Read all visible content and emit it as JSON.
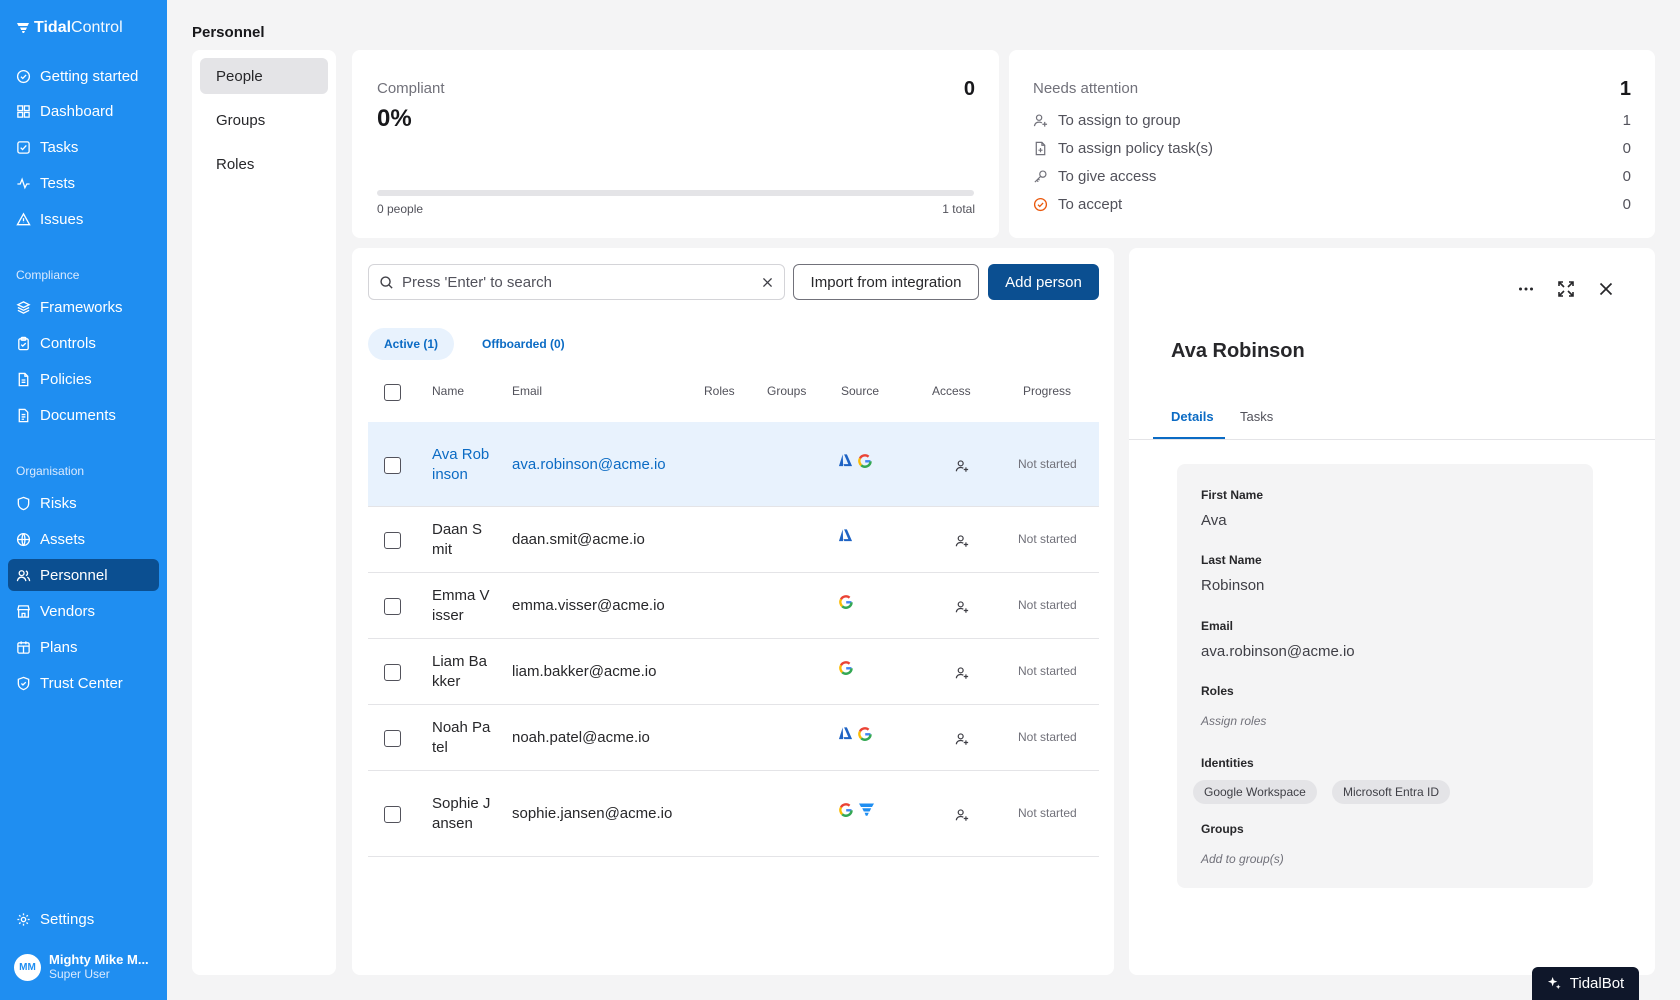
{
  "brand": {
    "bold": "Tidal",
    "light": "Control"
  },
  "nav": {
    "items": [
      {
        "label": "Getting started",
        "icon": "check-circle-icon"
      },
      {
        "label": "Dashboard",
        "icon": "grid-icon"
      },
      {
        "label": "Tasks",
        "icon": "checkbox-icon"
      },
      {
        "label": "Tests",
        "icon": "activity-icon"
      },
      {
        "label": "Issues",
        "icon": "warning-icon"
      }
    ],
    "compliance_label": "Compliance",
    "compliance_items": [
      {
        "label": "Frameworks",
        "icon": "layers-icon"
      },
      {
        "label": "Controls",
        "icon": "clipboard-icon"
      },
      {
        "label": "Policies",
        "icon": "file-icon"
      },
      {
        "label": "Documents",
        "icon": "document-icon"
      }
    ],
    "organisation_label": "Organisation",
    "organisation_items": [
      {
        "label": "Risks",
        "icon": "shield-icon"
      },
      {
        "label": "Assets",
        "icon": "globe-icon"
      },
      {
        "label": "Personnel",
        "icon": "users-icon"
      },
      {
        "label": "Vendors",
        "icon": "store-icon"
      },
      {
        "label": "Plans",
        "icon": "calendar-icon"
      },
      {
        "label": "Trust Center",
        "icon": "shield-check-icon"
      }
    ],
    "settings_label": "Settings"
  },
  "user": {
    "initials": "MM",
    "name": "Mighty Mike M...",
    "role": "Super User"
  },
  "page_title": "Personnel",
  "subnav": [
    "People",
    "Groups",
    "Roles"
  ],
  "compliant": {
    "label": "Compliant",
    "percent": "0%",
    "count": "0",
    "people_note": "0 people",
    "total_note": "1 total",
    "progress": 0
  },
  "needs_attention": {
    "label": "Needs attention",
    "count": "1",
    "rows": [
      {
        "label": "To assign to group",
        "count": "1",
        "icon": "user-plus-icon"
      },
      {
        "label": "To assign policy task(s)",
        "count": "0",
        "icon": "file-plus-icon"
      },
      {
        "label": "To give access",
        "count": "0",
        "icon": "key-icon"
      },
      {
        "label": "To accept",
        "count": "0",
        "icon": "check-circle-icon"
      }
    ]
  },
  "toolbar": {
    "search_placeholder": "Press 'Enter' to search",
    "import_label": "Import from integration",
    "add_label": "Add person"
  },
  "filters": {
    "active": "Active (1)",
    "offboarded": "Offboarded (0)"
  },
  "table": {
    "headers": {
      "name": "Name",
      "email": "Email",
      "roles": "Roles",
      "groups": "Groups",
      "source": "Source",
      "access": "Access",
      "progress": "Progress"
    },
    "rows": [
      {
        "name": "Ava Robinson",
        "email": "ava.robinson@acme.io",
        "sources": [
          "entra",
          "google"
        ],
        "progress": "Not started"
      },
      {
        "name": "Daan Smit",
        "email": "daan.smit@acme.io",
        "sources": [
          "entra"
        ],
        "progress": "Not started"
      },
      {
        "name": "Emma Visser",
        "email": "emma.visser@acme.io",
        "sources": [
          "google"
        ],
        "progress": "Not started"
      },
      {
        "name": "Liam Bakker",
        "email": "liam.bakker@acme.io",
        "sources": [
          "google"
        ],
        "progress": "Not started"
      },
      {
        "name": "Noah Patel",
        "email": "noah.patel@acme.io",
        "sources": [
          "entra",
          "google"
        ],
        "progress": "Not started"
      },
      {
        "name": "Sophie Jansen",
        "email": "sophie.jansen@acme.io",
        "sources": [
          "google",
          "tidal"
        ],
        "progress": "Not started"
      }
    ]
  },
  "detail": {
    "name": "Ava Robinson",
    "tabs": [
      "Details",
      "Tasks"
    ],
    "first_name_label": "First Name",
    "first_name": "Ava",
    "last_name_label": "Last Name",
    "last_name": "Robinson",
    "email_label": "Email",
    "email": "ava.robinson@acme.io",
    "roles_label": "Roles",
    "roles_placeholder": "Assign roles",
    "identities_label": "Identities",
    "identities": [
      "Google Workspace",
      "Microsoft Entra ID"
    ],
    "groups_label": "Groups",
    "groups_placeholder": "Add to group(s)"
  },
  "tidalbot_label": "TidalBot"
}
